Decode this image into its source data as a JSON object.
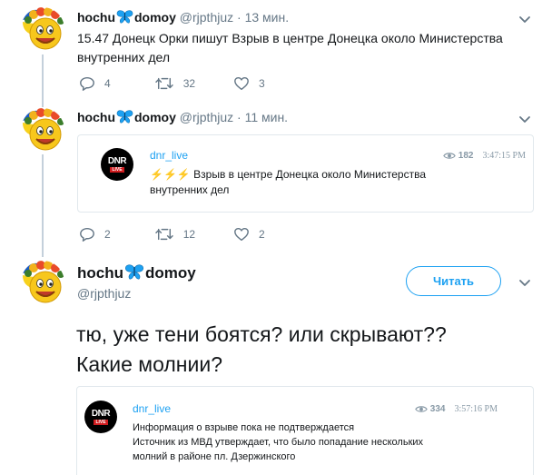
{
  "tweets": [
    {
      "name_part1": "hochu",
      "name_part2": "domoy",
      "handle": "@rjpthjuz",
      "time": "13 мин.",
      "text_line1": "15.47 Донецк Орки пишут Взрыв в центре Донецка около Министерства",
      "text_line2": "внутренних дел",
      "replies": "4",
      "retweets": "32",
      "likes": "3"
    },
    {
      "name_part1": "hochu",
      "name_part2": "domoy",
      "handle": "@rjpthjuz",
      "time": "11 мин.",
      "replies": "2",
      "retweets": "12",
      "likes": "2",
      "card": {
        "name": "dnr_live",
        "views": "182",
        "time": "3:47:15 PM",
        "text_line1": "⚡⚡⚡ Взрыв в центре Донецка около Министерства",
        "text_line2": "внутренних дел"
      }
    }
  ],
  "main_tweet": {
    "name_part1": "hochu",
    "name_part2": "domoy",
    "handle": "@rjpthjuz",
    "follow_label": "Читать",
    "text_line1": "тю, уже тени боятся? или скрывают??",
    "text_line2": "Какие молнии?",
    "card": {
      "name": "dnr_live",
      "views": "334",
      "time": "3:57:16 PM",
      "text_line1": "Информация о взрыве пока не подтверждается",
      "text_line2": "Источник из МВД утверждает, что было попадание нескольких",
      "text_line3": "молний в районе пл. Дзержинского"
    }
  },
  "card_logo": {
    "top": "DNR",
    "bottom": "LIVE"
  },
  "colors": {
    "accent": "#1da1f2",
    "muted": "#657786",
    "thread_line": "#c4d0db",
    "butterfly": "#1da1f2"
  },
  "icons": [
    "reply-icon",
    "retweet-icon",
    "like-icon",
    "caret-down-icon",
    "butterfly-icon",
    "views-icon",
    "sunflower-smiley-avatar"
  ]
}
